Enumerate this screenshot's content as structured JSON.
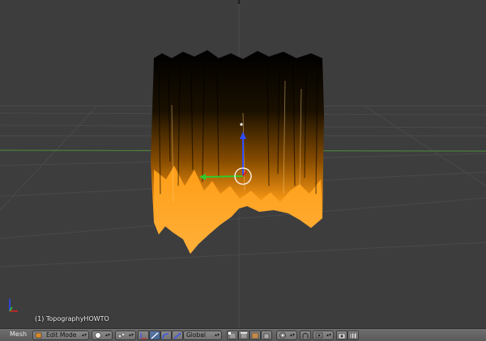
{
  "viewport": {
    "object_label": "(1) TopographyHOWTO"
  },
  "header": {
    "editor_label": "Mesh",
    "mode_select": "Edit Mode",
    "orientation_select": "Global",
    "icons": [
      "mode-cube-icon",
      "viewport-shading-icon",
      "pivot-point-icon",
      "manipulator-toggle-icon",
      "translate-icon",
      "rotate-icon",
      "scale-icon",
      "vertex-select-icon",
      "edge-select-icon",
      "face-select-icon",
      "proportional-editing-icon",
      "snap-icon",
      "snap-target-icon",
      "render-icon",
      "render-animation-icon"
    ]
  },
  "colors": {
    "viewport_bg": "#3d3d3d",
    "mesh_orange": "#ffa41c",
    "x_axis": "#6aa84f",
    "header_bg": "#646464"
  }
}
